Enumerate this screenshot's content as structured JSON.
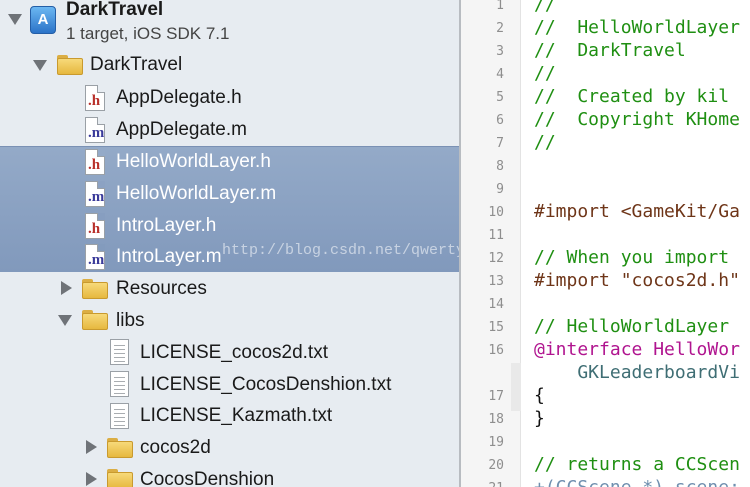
{
  "navigator": {
    "project": {
      "name": "DarkTravel",
      "subtitle": "1 target, iOS SDK 7.1",
      "icon": "xcode-project-icon"
    },
    "group": "DarkTravel",
    "files": [
      {
        "name": "AppDelegate.h",
        "ext": "h"
      },
      {
        "name": "AppDelegate.m",
        "ext": "m"
      },
      {
        "name": "HelloWorldLayer.h",
        "ext": "h"
      },
      {
        "name": "HelloWorldLayer.m",
        "ext": "m"
      },
      {
        "name": "IntroLayer.h",
        "ext": "h"
      },
      {
        "name": "IntroLayer.m",
        "ext": "m"
      }
    ],
    "resources": "Resources",
    "libs": "libs",
    "lib_files": [
      "LICENSE_cocos2d.txt",
      "LICENSE_CocosDenshion.txt",
      "LICENSE_Kazmath.txt"
    ],
    "subfolders": [
      "cocos2d",
      "CocosDenshion"
    ]
  },
  "watermark": "http://blog.csdn.net/qwertyupiuy",
  "editor": {
    "line_numbers": [
      "1",
      "2",
      "3",
      "4",
      "5",
      "6",
      "7",
      "8",
      "9",
      "10",
      "11",
      "12",
      "13",
      "14",
      "15",
      "16",
      "17",
      "18",
      "19",
      "20",
      "21"
    ],
    "lines": [
      "//",
      "//  HelloWorldLayer",
      "//  DarkTravel",
      "//",
      "//  Created by kil",
      "//  Copyright KHome",
      "//",
      "",
      "",
      "#import <GameKit/Ga",
      "",
      "// When you import",
      "#import \"cocos2d.h\"",
      "",
      "// HelloWorldLayer",
      "@interface HelloWor",
      "    GKLeaderboardVi",
      "{",
      "}",
      "",
      "// returns a CCScen",
      "+(CCScene *) scene;"
    ]
  },
  "colors": {
    "selection": "#8ba2c2",
    "comment": "#1f8f12",
    "keyword": "#b0148f",
    "string": "#c41a16",
    "folder": "#f0c95a"
  }
}
